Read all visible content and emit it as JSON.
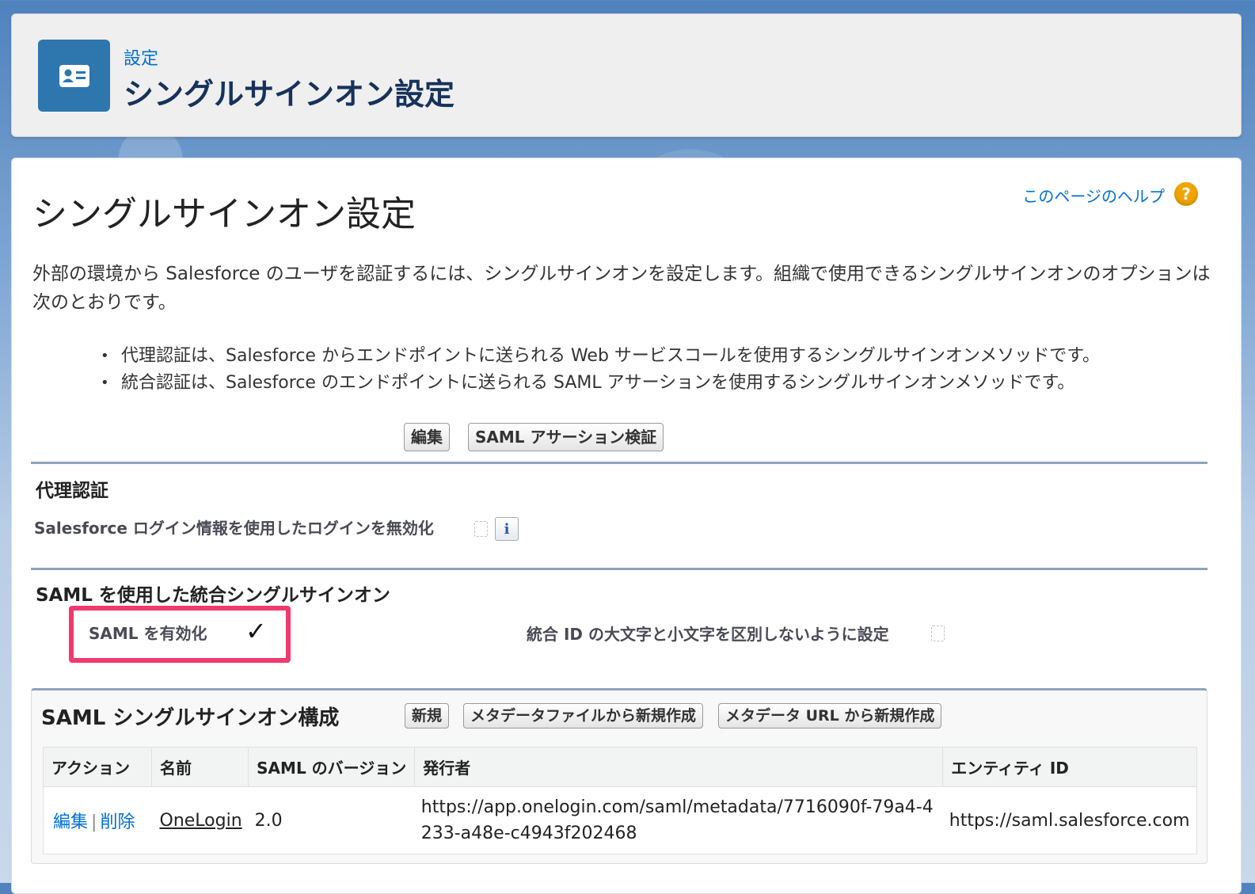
{
  "header": {
    "breadcrumb": "設定",
    "title": "シングルサインオン設定",
    "icon": "contact-card-icon"
  },
  "page": {
    "title": "シングルサインオン設定",
    "help_link": "このページのヘルプ",
    "help_icon": "?",
    "intro": "外部の環境から Salesforce のユーザを認証するには、シングルサインオンを設定します。組織で使用できるシングルサインオンのオプションは次のとおりです。",
    "bullets": [
      "代理認証は、Salesforce からエンドポイントに送られる Web サービスコールを使用するシングルサインオンメソッドです。",
      "統合認証は、Salesforce のエンドポイントに送られる SAML アサーションを使用するシングルサインオンメソッドです。"
    ],
    "buttons": {
      "edit": "編集",
      "validate_saml": "SAML アサーション検証"
    }
  },
  "delegated": {
    "title": "代理認証",
    "disable_login_label": "Salesforce ログイン情報を使用したログインを無効化",
    "info_icon": "i"
  },
  "saml": {
    "title": "SAML を使用した統合シングルサインオン",
    "enable_label": "SAML を有効化",
    "enable_checked": "✓",
    "case_insensitive_label": "統合 ID の大文字と小文字を区別しないように設定"
  },
  "config": {
    "title": "SAML シングルサインオン構成",
    "buttons": {
      "new": "新規",
      "new_from_file": "メタデータファイルから新規作成",
      "new_from_url": "メタデータ URL から新規作成"
    },
    "columns": [
      "アクション",
      "名前",
      "SAML のバージョン",
      "発行者",
      "エンティティ ID"
    ],
    "rows": [
      {
        "action_edit": "編集",
        "action_sep": "|",
        "action_delete": "削除",
        "name": "OneLogin",
        "version": "2.0",
        "issuer": "https://app.onelogin.com/saml/metadata/7716090f-79a4-4233-a48e-c4943f202468",
        "entity_id": "https://saml.salesforce.com"
      }
    ]
  },
  "colors": {
    "link": "#0070d2",
    "header_icon_bg": "#2e76ae",
    "highlight": "#f0396d",
    "help_icon": "#f0a400"
  }
}
